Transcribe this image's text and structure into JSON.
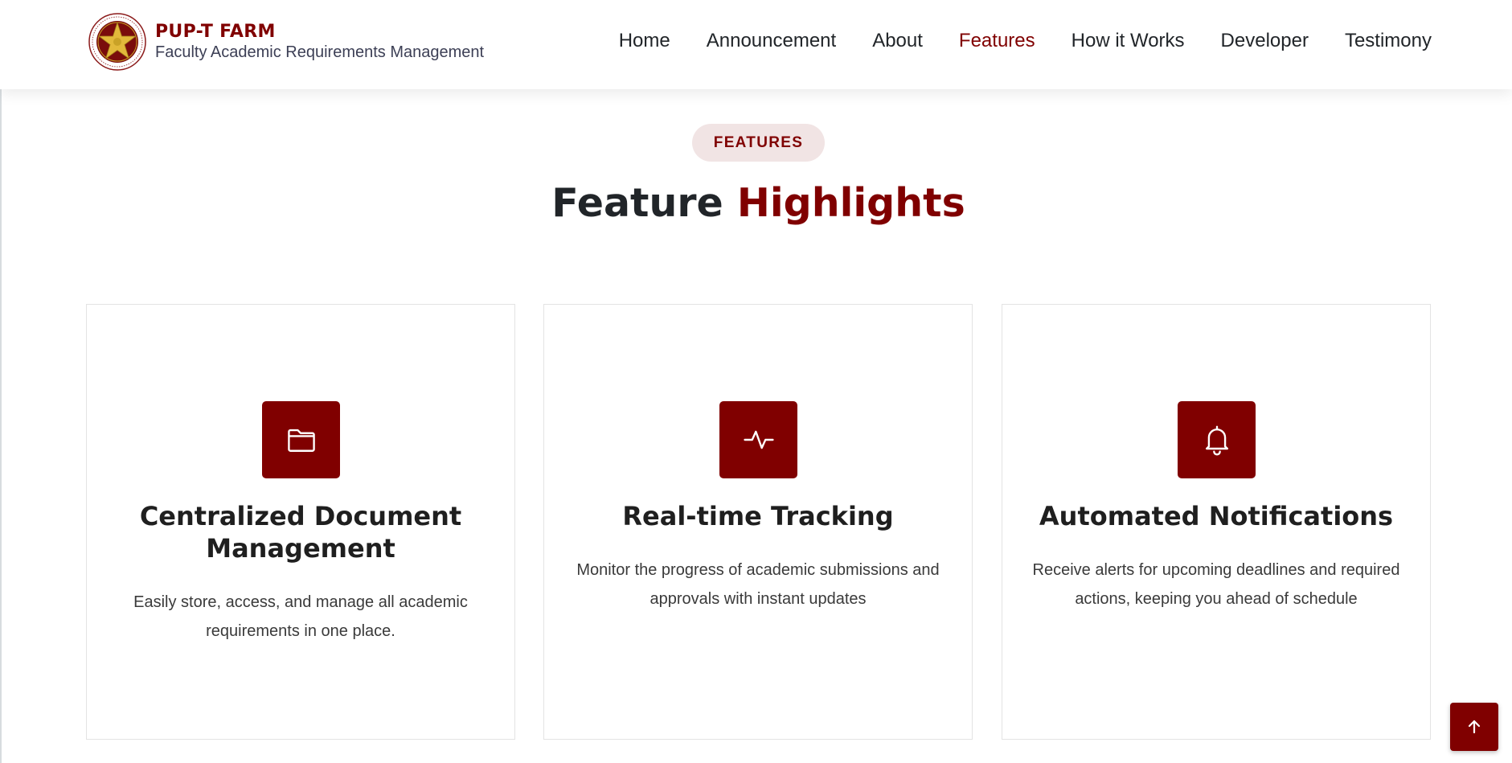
{
  "brand": {
    "title": "PUP-T FARM",
    "subtitle": "Faculty Academic Requirements Management",
    "logo_icon": "university-seal-icon"
  },
  "nav": {
    "items": [
      {
        "label": "Home"
      },
      {
        "label": "Announcement"
      },
      {
        "label": "About"
      },
      {
        "label": "Features",
        "active": true
      },
      {
        "label": "How it Works"
      },
      {
        "label": "Developer"
      },
      {
        "label": "Testimony"
      }
    ]
  },
  "section": {
    "tag": "FEATURES",
    "title_main": "Feature",
    "title_accent": "Highlights"
  },
  "features": [
    {
      "icon": "folder-icon",
      "title": "Centralized Document Management",
      "description": "Easily store, access, and manage all academic requirements in one place."
    },
    {
      "icon": "activity-icon",
      "title": "Real-time Tracking",
      "description": "Monitor the progress of academic submissions and approvals with instant updates"
    },
    {
      "icon": "bell-icon",
      "title": "Automated Notifications",
      "description": "Receive alerts for upcoming deadlines and required actions, keeping you ahead of schedule"
    }
  ],
  "back_to_top": {
    "icon": "arrow-up-icon"
  },
  "colors": {
    "brand": "#800000",
    "pill_bg": "#f1e4e4",
    "text": "#212529"
  }
}
